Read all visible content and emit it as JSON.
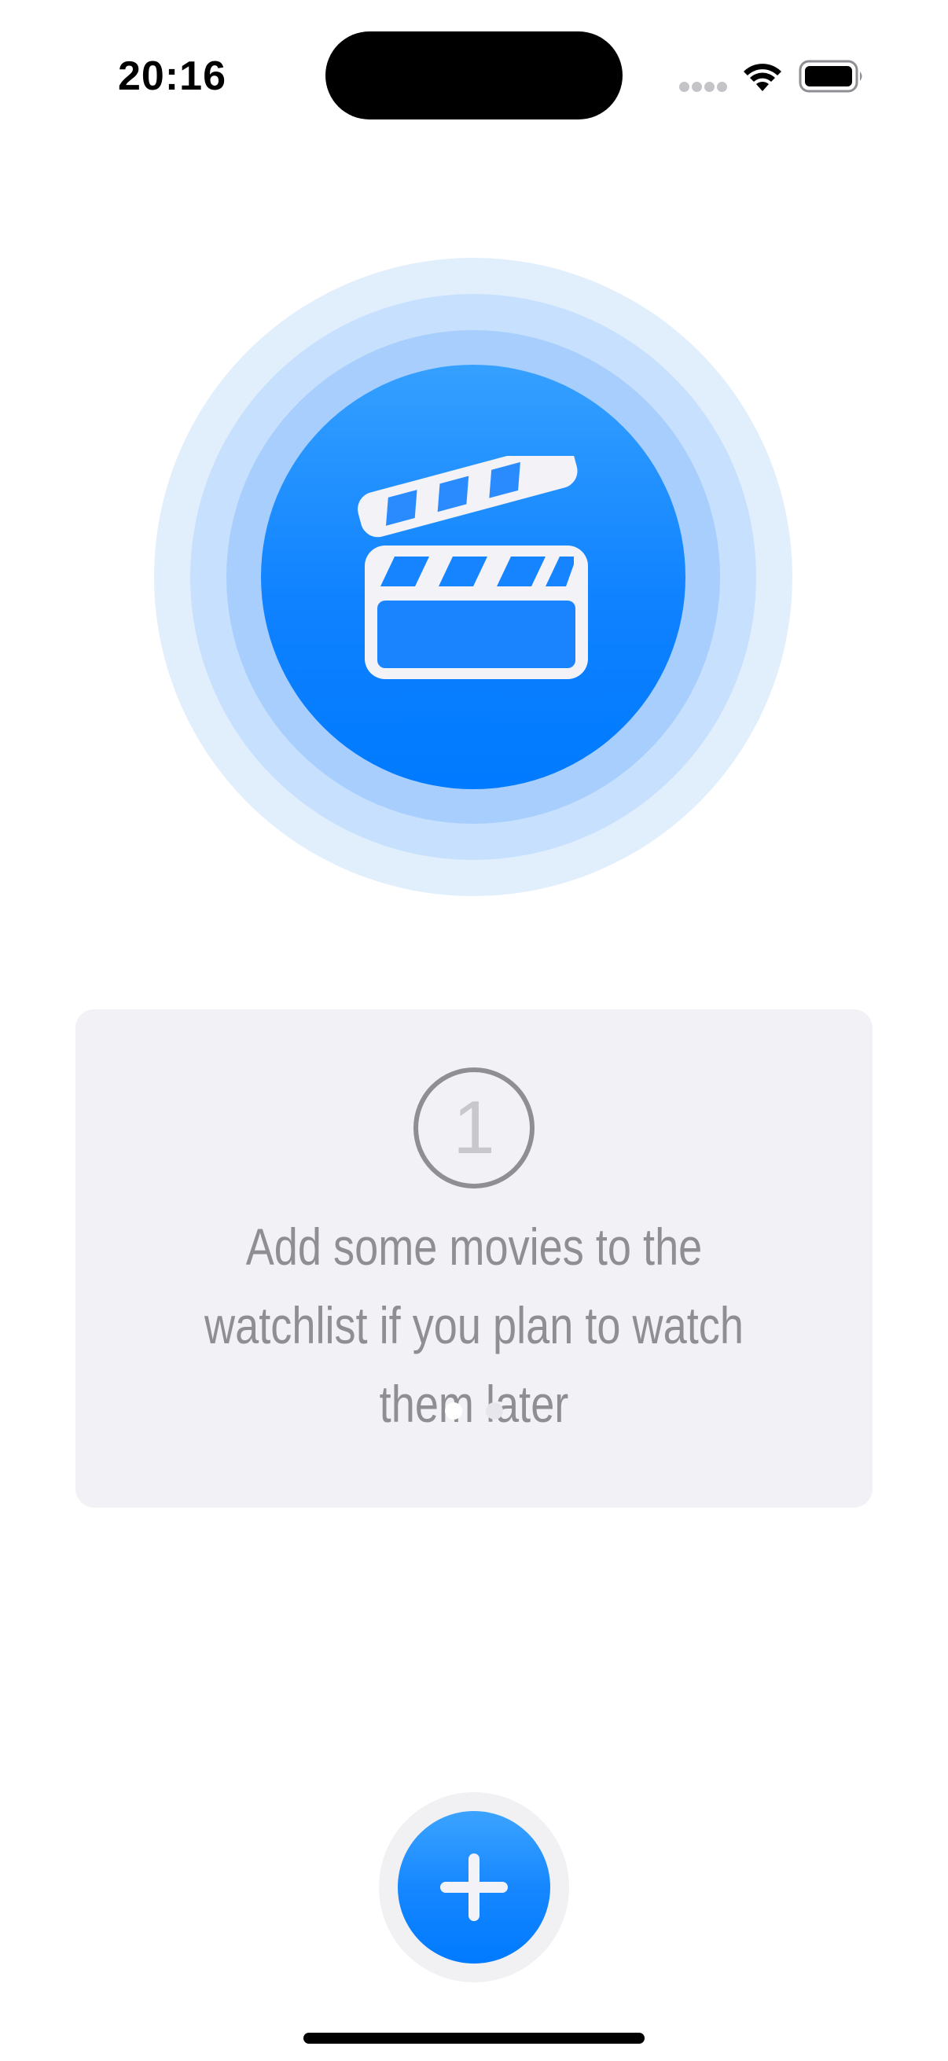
{
  "status_bar": {
    "time": "20:16"
  },
  "hero": {
    "icon": "clapperboard-icon",
    "accent_color": "#007aff"
  },
  "tip_card": {
    "step_number": "1",
    "message": "Add some movies to the watchlist if you plan to watch them later",
    "page_indicator": {
      "total_pages": 2,
      "current_page": 1,
      "active_color": "#ffffff",
      "inactive_color": "#e6e6ec"
    }
  },
  "add_button": {
    "icon": "plus-icon",
    "color": "#007aff"
  }
}
